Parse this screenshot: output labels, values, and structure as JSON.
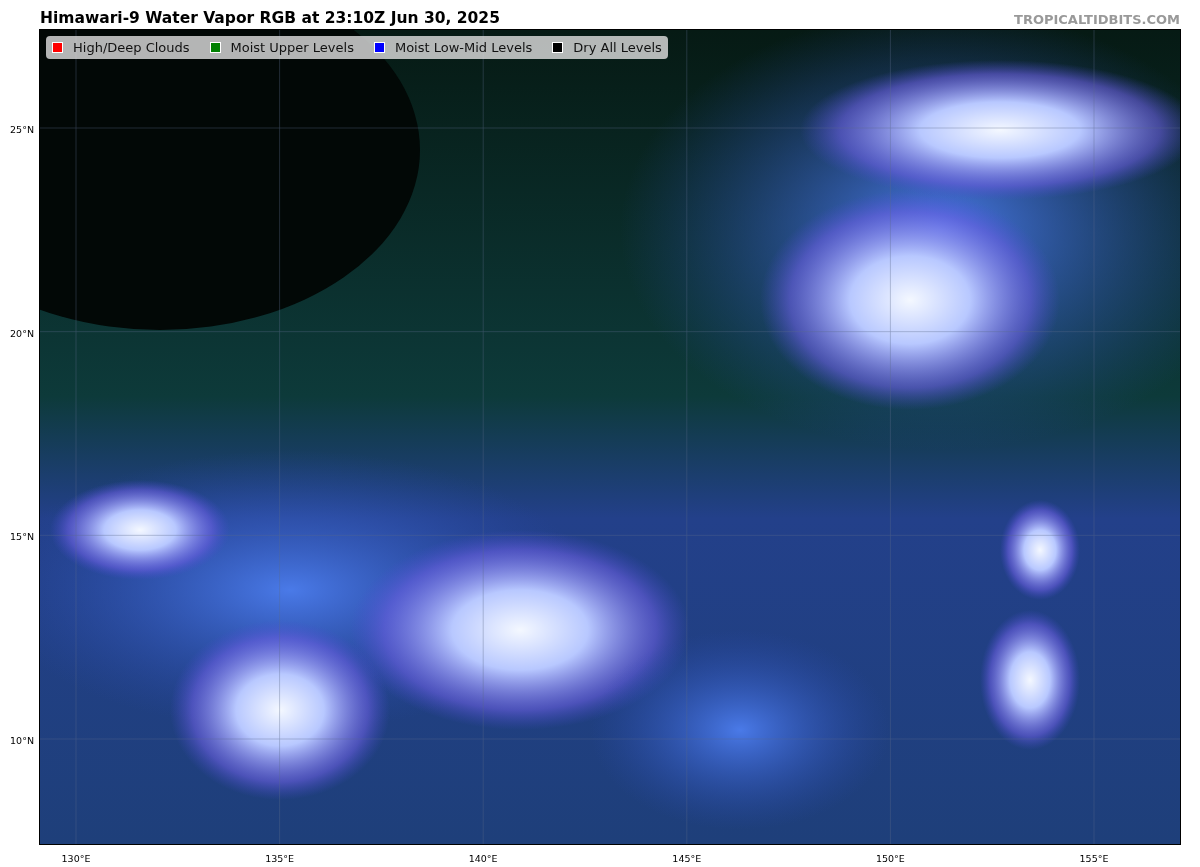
{
  "title": "Himawari-9 Water Vapor RGB at 23:10Z Jun 30, 2025",
  "credit": "TROPICALTIDBITS.COM",
  "legend": [
    {
      "label": "High/Deep Clouds",
      "color": "#ff0000"
    },
    {
      "label": "Moist Upper Levels",
      "color": "#008000"
    },
    {
      "label": "Moist Low-Mid Levels",
      "color": "#0000ff"
    },
    {
      "label": "Dry All Levels",
      "color": "#000000"
    }
  ],
  "lat_labels": [
    "25°N",
    "20°N",
    "15°N",
    "10°N"
  ],
  "lon_labels": [
    "130°E",
    "135°E",
    "140°E",
    "145°E",
    "150°E",
    "155°E"
  ]
}
